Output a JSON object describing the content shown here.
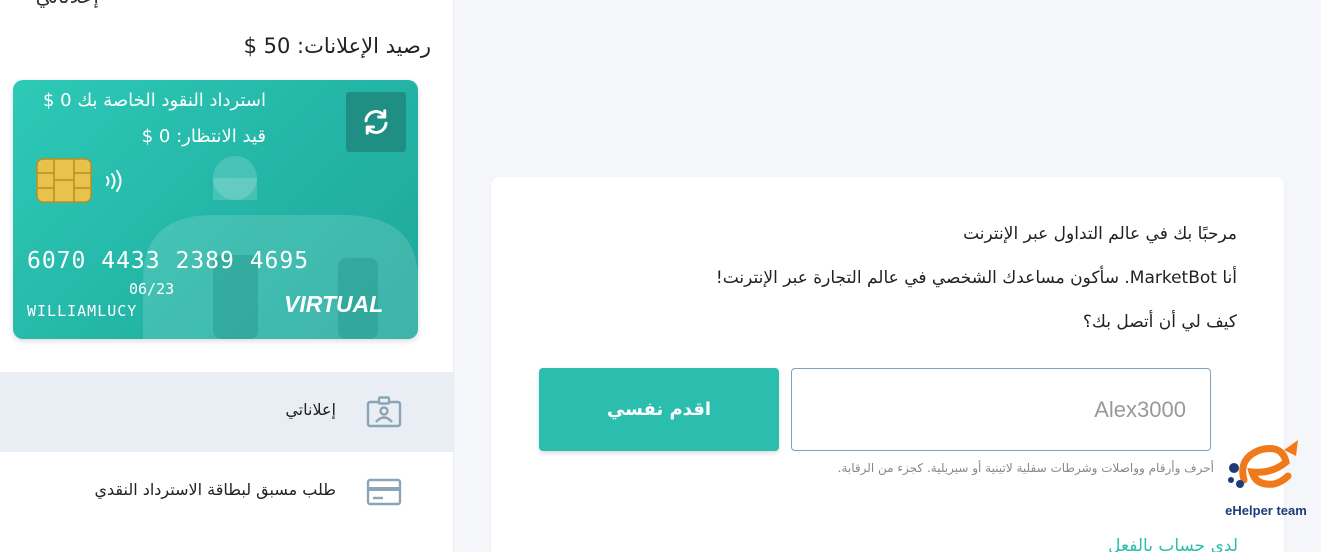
{
  "sidebar": {
    "heading": "إعلاناتي",
    "balance": "رصيد الإعلانات: 50 $",
    "card": {
      "cashback": "استرداد النقود الخاصة بك 0 $",
      "pending": "قيد الانتظار: 0 $",
      "number": "6070 4433 2389 4695",
      "expiry": "06/23",
      "holder": "WILLIAMLUCY",
      "type": "VIRTUAL",
      "refresh_icon": "refresh-icon",
      "chip_icon": "chip-icon",
      "contactless_icon": "contactless-icon"
    },
    "items": [
      {
        "label": "إعلاناتي",
        "icon": "id-card-icon",
        "active": true
      },
      {
        "label": "طلب مسبق لبطاقة الاسترداد النقدي",
        "icon": "credit-card-icon",
        "active": false
      }
    ]
  },
  "chat": {
    "line1": "مرحبًا بك في عالم التداول عبر الإنترنت",
    "line2": "أنا MarketBot. سأكون مساعدك الشخصي في عالم التجارة عبر الإنترنت!",
    "line3": "كيف لي أن أتصل بك؟",
    "input_placeholder": "Alex3000",
    "submit_label": "اقدم نفسي",
    "hint": "أحرف وأرقام وواصلات وشرطات سفلية لاتينية أو سيريلية. كجزء من الرقابة.",
    "login_link": "لدي حساب بالفعل"
  },
  "badge": {
    "text": "eHelper team"
  },
  "colors": {
    "accent": "#2bbdad",
    "card_start": "#2ec9b8",
    "card_end": "#1fa89b",
    "active_item_bg": "#e8eef3",
    "page_bg": "#f4f6f9"
  }
}
